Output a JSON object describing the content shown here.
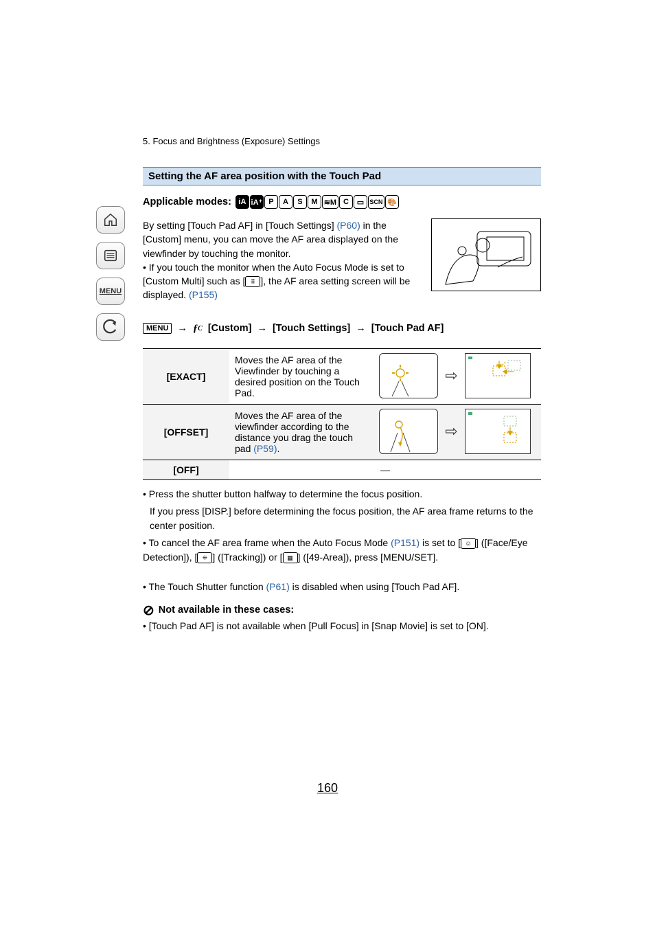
{
  "chapter": "5. Focus and Brightness (Exposure) Settings",
  "section_title": "Setting the AF area position with the Touch Pad",
  "applicable_label": "Applicable modes:",
  "modes": [
    "iA",
    "iA+",
    "P",
    "A",
    "S",
    "M",
    "≋M",
    "C",
    "□",
    "SCN",
    "⦿"
  ],
  "intro": {
    "part1": "By setting [Touch Pad AF] in [Touch Settings] ",
    "link1_text": "(P60)",
    "part2": " in the [Custom] menu, you can move the AF area displayed on the viewfinder by touching the monitor.",
    "bullet1a": "• If you touch the monitor when the Auto Focus Mode is set to [Custom Multi] such as [",
    "bullet1_mid": "], the AF area setting screen will be displayed. ",
    "link2_text": "(P155)"
  },
  "menu_path": {
    "menu_pill": "MENU",
    "custom_label": "[Custom]",
    "touch_settings_label": "[Touch Settings]",
    "touch_pad_af_label": "[Touch Pad AF]"
  },
  "table": {
    "exact": {
      "name": "[EXACT]",
      "desc": "Moves the AF area of the Viewfinder by touching a desired position on the Touch Pad."
    },
    "offset": {
      "name": "[OFFSET]",
      "desc_a": "Moves the AF area of the viewfinder according to the distance you drag the touch pad ",
      "link_text": "(P59)",
      "desc_b": "."
    },
    "off": {
      "name": "[OFF]",
      "desc": "—"
    }
  },
  "notes": {
    "n1": "• Press the shutter button halfway to determine the focus position.",
    "n1b": "If you press [DISP.] before determining the focus position, the AF area frame returns to the center position.",
    "n2a": "• To cancel the AF area frame when the Auto Focus Mode ",
    "n2_link": "(P151)",
    "n2b": " is set to [",
    "n2c": "] ([Face/Eye Detection]), [",
    "n2d": "] ([Tracking]) or [",
    "n2e": "] ([49-Area]), press [MENU/SET].",
    "disabled_a": "• The Touch Shutter function ",
    "disabled_link": "(P61)",
    "disabled_b": " is disabled when using [Touch Pad AF].",
    "not_avail_title": "Not available in these cases:",
    "not_avail_item": "• [Touch Pad AF] is not available when [Pull Focus] in [Snap Movie] is set to [ON]."
  },
  "page_number": "160",
  "sidebar": {
    "menu_label": "MENU"
  }
}
